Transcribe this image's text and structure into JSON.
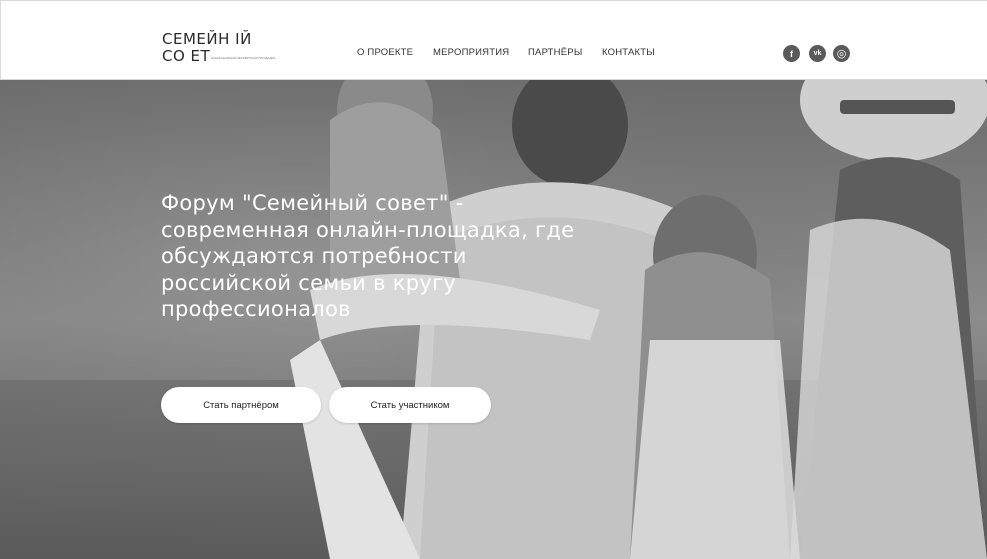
{
  "logo": {
    "line1": "СЕМЕЙН  ІЙ",
    "line2": "СО  ЕТ",
    "tagline": "НАЦИОНАЛЬНАЯ ЭКСПЕРТНАЯ ПЛОЩАДКА"
  },
  "nav": {
    "items": [
      {
        "label": "О ПРОЕКТЕ"
      },
      {
        "label": "МЕРОПРИЯТИЯ"
      },
      {
        "label": "ПАРТНЁРЫ"
      },
      {
        "label": "КОНТАКТЫ"
      }
    ]
  },
  "social": {
    "facebook": "f",
    "vk": "vk",
    "instagram": "◎"
  },
  "hero": {
    "title": "Форум \"Семейный совет\" - современная онлайн-площадка, где обсуждаются потребности российской семьи в кругу профессионалов",
    "buttons": {
      "partner": "Стать партнёром",
      "participant": "Стать участником"
    }
  },
  "colors": {
    "header_bg": "#ffffff",
    "hero_overlay": "#7d7d7d",
    "button_bg": "#ffffff",
    "text_light": "#ffffff",
    "social_icon": "#5a5a5a"
  },
  "icons": [
    "facebook-icon",
    "vk-icon",
    "instagram-icon"
  ]
}
